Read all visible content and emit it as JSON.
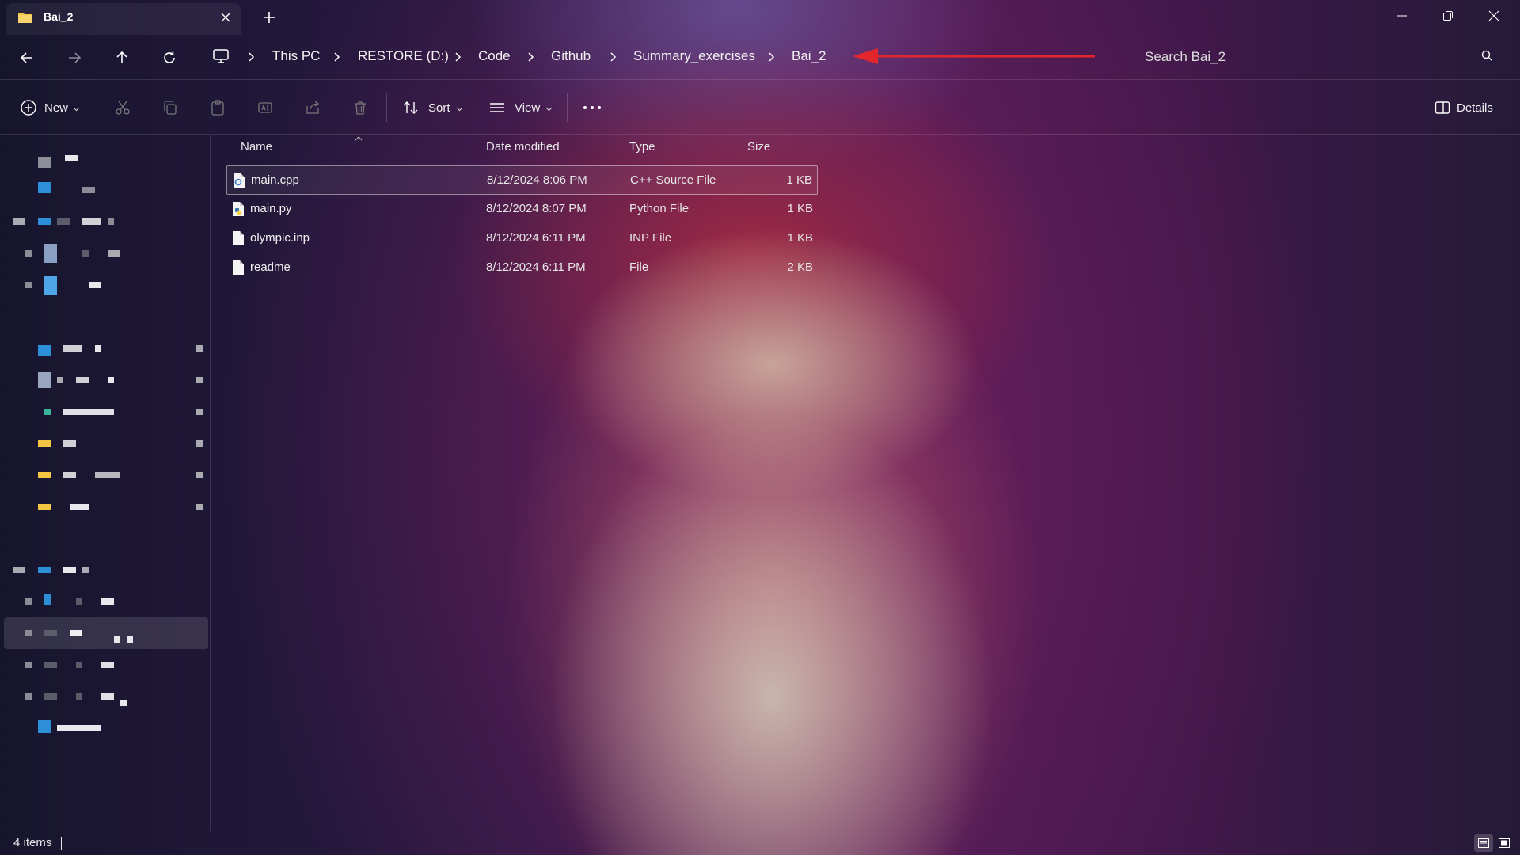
{
  "window": {
    "tab_title": "Bai_2",
    "tab_icon": "folder-icon",
    "new_tab_icon": "plus-icon"
  },
  "address_bar": {
    "root_icon": "this-pc-icon",
    "breadcrumbs": [
      "This PC",
      "RESTORE (D:)",
      "Code",
      "Github",
      "Summary_exercises",
      "Bai_2"
    ],
    "search_placeholder": "Search Bai_2",
    "annotation_color": "#e3262b"
  },
  "command_bar": {
    "new_label": "New",
    "sort_label": "Sort",
    "view_label": "View",
    "details_label": "Details",
    "icons": [
      "cut-icon",
      "copy-icon",
      "paste-icon",
      "rename-icon",
      "share-icon",
      "delete-icon"
    ]
  },
  "file_list": {
    "columns": [
      "Name",
      "Date modified",
      "Type",
      "Size"
    ],
    "rows": [
      {
        "name": "main.cpp",
        "date": "8/12/2024 8:06 PM",
        "type": "C++ Source File",
        "size": "1 KB",
        "icon": "cpp-file-icon"
      },
      {
        "name": "main.py",
        "date": "8/12/2024 8:07 PM",
        "type": "Python File",
        "size": "1 KB",
        "icon": "python-file-icon"
      },
      {
        "name": "olympic.inp",
        "date": "8/12/2024 6:11 PM",
        "type": "INP File",
        "size": "1 KB",
        "icon": "file-icon"
      },
      {
        "name": "readme",
        "date": "8/12/2024 6:11 PM",
        "type": "File",
        "size": "2 KB",
        "icon": "file-icon"
      }
    ]
  },
  "status_bar": {
    "item_count": "4 items"
  },
  "colors": {
    "accent_blue": "#2d8fd8",
    "folder_yellow": "#f4c542"
  }
}
